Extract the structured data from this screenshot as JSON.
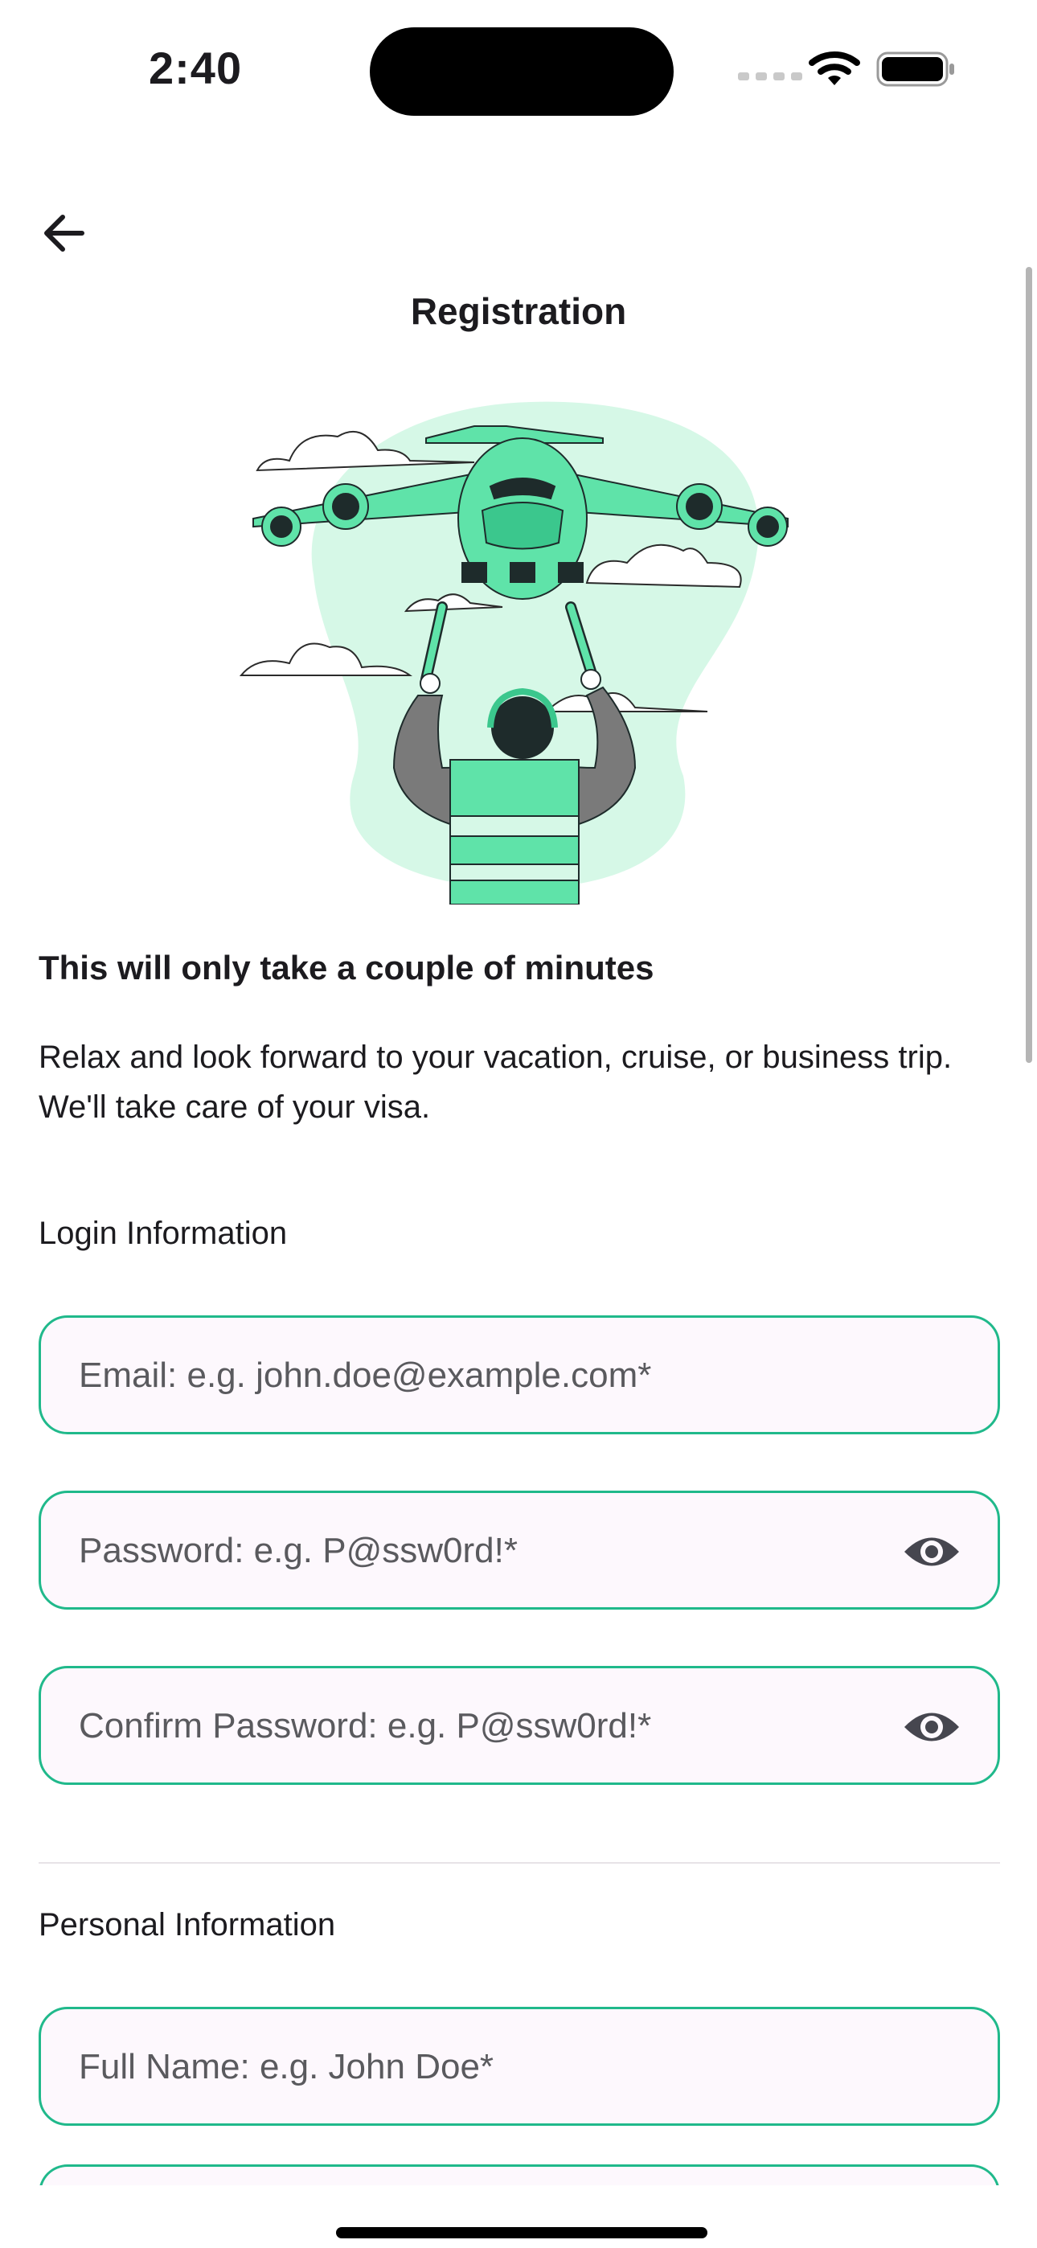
{
  "status_bar": {
    "time": "2:40"
  },
  "header": {
    "title": "Registration"
  },
  "intro": {
    "headline": "This will only take a couple of minutes",
    "body": "Relax and look forward to your vacation, cruise, or business trip. We'll take care of your visa."
  },
  "login": {
    "section_label": "Login Information",
    "email_placeholder": "Email: e.g. john.doe@example.com*",
    "password_placeholder": "Password: e.g. P@ssw0rd!*",
    "confirm_password_placeholder": "Confirm Password: e.g. P@ssw0rd!*"
  },
  "personal": {
    "section_label": "Personal Information",
    "full_name_placeholder": "Full Name: e.g. John Doe*"
  },
  "icons": {
    "back": "arrow-left-icon",
    "eye": "eye-icon",
    "wifi": "wifi-icon",
    "battery": "battery-icon"
  },
  "colors": {
    "accent": "#20b98b",
    "illustration_green": "#5fe3a9",
    "illustration_bg": "#d6f8e7",
    "field_bg": "#fdf8fd"
  }
}
